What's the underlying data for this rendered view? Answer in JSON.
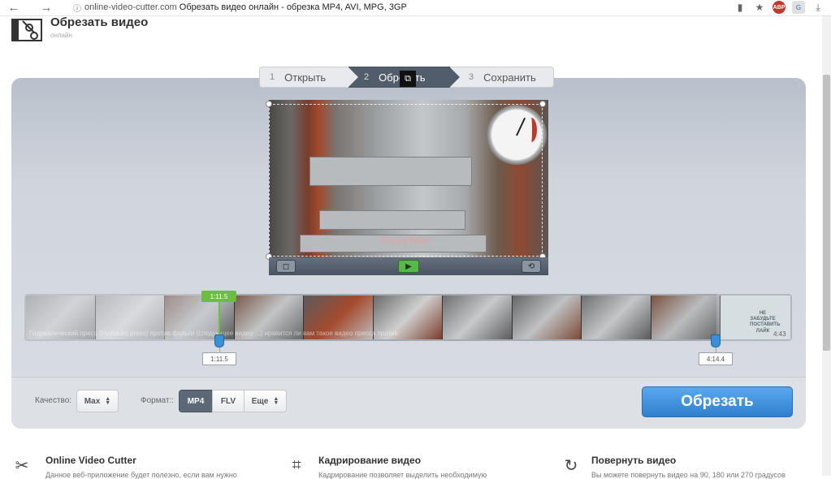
{
  "browser": {
    "url_host": "online-video-cutter.com",
    "page_title": "Обрезать видео онлайн - обрезка MP4, AVI, MPG, 3GP",
    "abp_badge": "ABP",
    "ext_badge": "G"
  },
  "site": {
    "title": "Обрезать видео",
    "subtitle": "онлайн"
  },
  "steps": [
    {
      "num": "1",
      "label": "Открыть"
    },
    {
      "num": "2",
      "label": "Обрезать"
    },
    {
      "num": "3",
      "label": "Сохранить"
    }
  ],
  "video": {
    "watermark": "PressTube"
  },
  "timeline": {
    "playhead_time": "1:11.5",
    "start_time": "1:11.5",
    "end_time": "4:14.4",
    "duration": "4:43",
    "caption": "Гидравлический пресс (Hydraulic press) против фольги (следующее видео ...) нравится ли вам такое видео пресса против",
    "end_screen_text": "НЕ ЗАБУДЬТЕ ПОСТАВИТЬ ЛАЙК"
  },
  "options": {
    "quality_label": "Качество:",
    "quality_value": "Max",
    "format_label": "Формат::",
    "formats": [
      "MP4",
      "FLV",
      "Еще"
    ],
    "active_format": "MP4"
  },
  "cut_button_label": "Обрезать",
  "features": [
    {
      "title": "Online Video Cutter",
      "text": "Данное веб-приложение будет полезно, если вам нужно",
      "icon": "film-cut-icon"
    },
    {
      "title": "Кадрирование видео",
      "text": "Кадрирование позволяет выделить необходимую",
      "icon": "crop-icon"
    },
    {
      "title": "Повернуть видео",
      "text": "Вы можете повернуть видео на 90, 180 или 270 градусов",
      "icon": "rotate-icon"
    }
  ],
  "colors": {
    "accent_blue": "#3b8fd6",
    "playhead_green": "#6dbd3f",
    "active_step": "#525d6b"
  }
}
